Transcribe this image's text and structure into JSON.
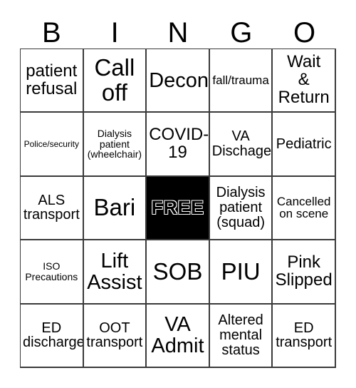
{
  "card": {
    "header_letters": [
      "B",
      "I",
      "N",
      "G",
      "O"
    ],
    "columns": 5,
    "rows": 5,
    "free_space_label": "FREE",
    "free_space_position": "center",
    "background_color": "#ffffff",
    "border_color": "#3a3a3a",
    "text_color": "#000000",
    "free_space_background": "#000000",
    "free_space_text_color": "#ffffff",
    "cells": [
      {
        "id": "cell-0-0",
        "text": "patient\nrefusal",
        "size": "lg",
        "free": false
      },
      {
        "id": "cell-0-1",
        "text": "Call\noff",
        "size": "xxl",
        "free": false
      },
      {
        "id": "cell-0-2",
        "text": "Decon",
        "size": "xl",
        "free": false
      },
      {
        "id": "cell-0-3",
        "text": "fall/trauma",
        "size": "sm",
        "free": false
      },
      {
        "id": "cell-0-4",
        "text": "Wait\n&\nReturn",
        "size": "lg",
        "free": false
      },
      {
        "id": "cell-1-0",
        "text": "Police/security",
        "size": "xxs",
        "free": false
      },
      {
        "id": "cell-1-1",
        "text": "Dialysis\npatient\n(wheelchair)",
        "size": "xs",
        "free": false
      },
      {
        "id": "cell-1-2",
        "text": "COVID-\n19",
        "size": "lg",
        "free": false
      },
      {
        "id": "cell-1-3",
        "text": "VA\nDischage",
        "size": "md",
        "free": false
      },
      {
        "id": "cell-1-4",
        "text": "Pediatric",
        "size": "md",
        "free": false
      },
      {
        "id": "cell-2-0",
        "text": "ALS\ntransport",
        "size": "md",
        "free": false
      },
      {
        "id": "cell-2-1",
        "text": "Bari",
        "size": "xxl",
        "free": false
      },
      {
        "id": "cell-2-2",
        "text": "FREE",
        "size": "xl",
        "free": true
      },
      {
        "id": "cell-2-3",
        "text": "Dialysis\npatient\n(squad)",
        "size": "md",
        "free": false
      },
      {
        "id": "cell-2-4",
        "text": "Cancelled\non scene",
        "size": "sm",
        "free": false
      },
      {
        "id": "cell-3-0",
        "text": "ISO\nPrecautions",
        "size": "xs",
        "free": false
      },
      {
        "id": "cell-3-1",
        "text": "Lift\nAssist",
        "size": "xl",
        "free": false
      },
      {
        "id": "cell-3-2",
        "text": "SOB",
        "size": "xxl",
        "free": false
      },
      {
        "id": "cell-3-3",
        "text": "PIU",
        "size": "xxl",
        "free": false
      },
      {
        "id": "cell-3-4",
        "text": "Pink\nSlipped",
        "size": "lg",
        "free": false
      },
      {
        "id": "cell-4-0",
        "text": "ED\ndischarge",
        "size": "md",
        "free": false
      },
      {
        "id": "cell-4-1",
        "text": "OOT\ntransport",
        "size": "md",
        "free": false
      },
      {
        "id": "cell-4-2",
        "text": "VA\nAdmit",
        "size": "xl",
        "free": false
      },
      {
        "id": "cell-4-3",
        "text": "Altered\nmental\nstatus",
        "size": "md",
        "free": false
      },
      {
        "id": "cell-4-4",
        "text": "ED\ntransport",
        "size": "md",
        "free": false
      }
    ]
  }
}
